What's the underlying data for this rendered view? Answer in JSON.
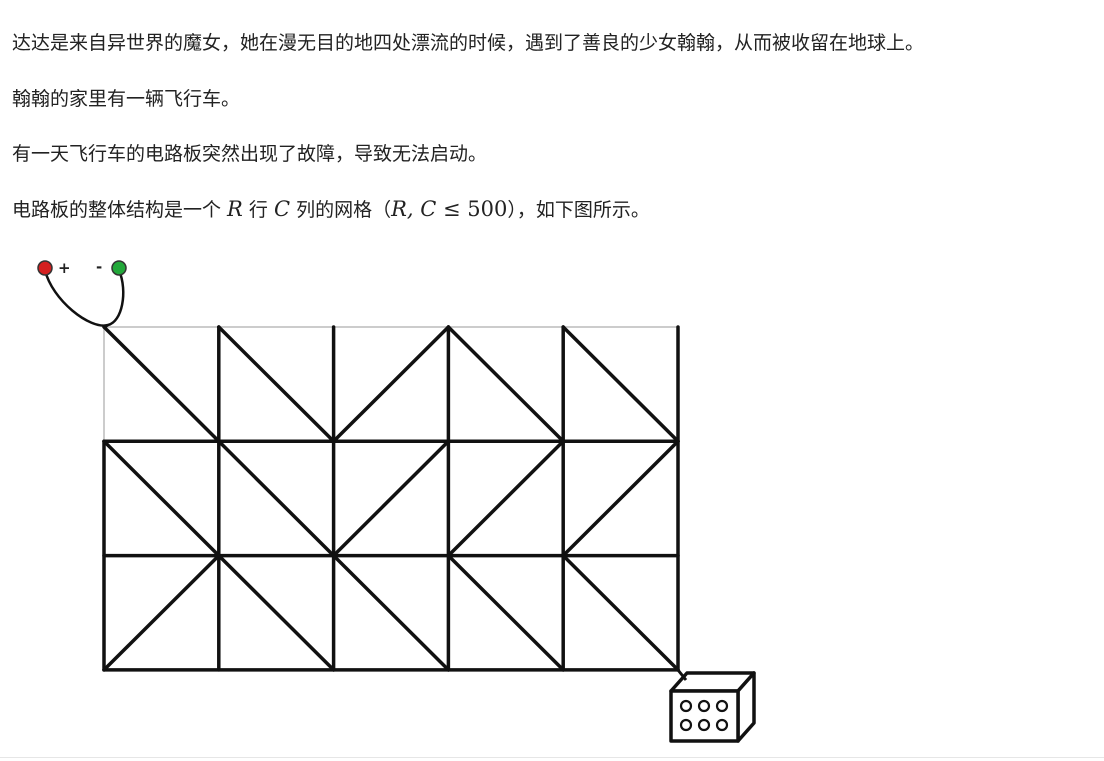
{
  "paragraphs": [
    "达达是来自异世界的魔女，她在漫无目的地四处漂流的时候，遇到了善良的少女翰翰，从而被收留在地球上。",
    "翰翰的家里有一辆飞行车。",
    "有一天飞行车的电路板突然出现了故障，导致无法启动。"
  ],
  "p4": {
    "pre": "电路板的整体结构是一个 ",
    "r": "R",
    "mid1": " 行 ",
    "c": "C",
    "mid2": " 列的网格（",
    "cond_vars": "R, C",
    "cond_rel": " ≤ 500",
    "post": "），如下图所示。"
  },
  "figure": {
    "plus_label": "+",
    "minus_label": "-",
    "colors": {
      "positive_terminal": "#d42020",
      "negative_terminal": "#22a83a",
      "wire": "#111111",
      "frame": "#cccccc"
    },
    "grid": {
      "rows": 3,
      "cols": 5,
      "diagonals": [
        [
          "\\",
          "\\",
          "/",
          "\\",
          "\\"
        ],
        [
          "\\",
          "\\",
          "/",
          "/",
          "/"
        ],
        [
          "/",
          "\\",
          "\\",
          "\\",
          "\\"
        ]
      ]
    }
  }
}
